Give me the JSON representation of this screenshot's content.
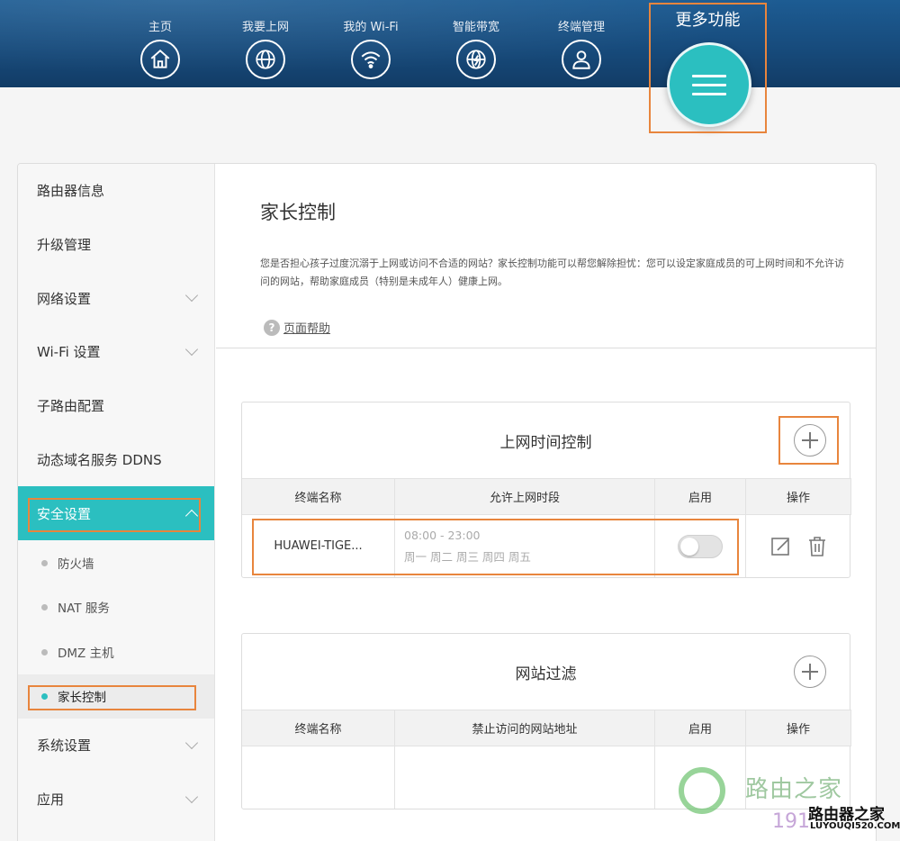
{
  "nav": {
    "items": [
      {
        "label": "主页",
        "icon": "home-icon"
      },
      {
        "label": "我要上网",
        "icon": "globe-icon"
      },
      {
        "label": "我的 Wi-Fi",
        "icon": "wifi-icon"
      },
      {
        "label": "智能带宽",
        "icon": "bandwidth-icon"
      },
      {
        "label": "终端管理",
        "icon": "user-icon"
      }
    ],
    "more_label": "更多功能"
  },
  "sidebar": {
    "items": [
      {
        "label": "路由器信息"
      },
      {
        "label": "升级管理"
      },
      {
        "label": "网络设置"
      },
      {
        "label": "Wi-Fi 设置"
      },
      {
        "label": "子路由配置"
      },
      {
        "label": "动态域名服务 DDNS"
      },
      {
        "label": "安全设置"
      }
    ],
    "sub_items": [
      {
        "label": "防火墙"
      },
      {
        "label": "NAT 服务"
      },
      {
        "label": "DMZ 主机"
      },
      {
        "label": "家长控制"
      }
    ],
    "bottom_items": [
      {
        "label": "系统设置"
      },
      {
        "label": "应用"
      }
    ]
  },
  "content": {
    "title": "家长控制",
    "description": "您是否担心孩子过度沉溺于上网或访问不合适的网站？家长控制功能可以帮您解除担忧：您可以设定家庭成员的可上网时间和不允许访问的网站，帮助家庭成员（特别是未成年人）健康上网。",
    "help_label": "页面帮助"
  },
  "time_control": {
    "title": "上网时间控制",
    "columns": [
      "终端名称",
      "允许上网时段",
      "启用",
      "操作"
    ],
    "rows": [
      {
        "device": "HUAWEI-TIGE...",
        "time": "08:00 - 23:00",
        "days": "周一 周二 周三 周四 周五",
        "enabled": false
      }
    ]
  },
  "site_filter": {
    "title": "网站过滤",
    "columns": [
      "终端名称",
      "禁止访问的网站地址",
      "启用",
      "操作"
    ]
  },
  "watermark": {
    "text": "路由之家",
    "sub": "路由器之家",
    "num": "191",
    "url": "LUYOUQI520.COM"
  },
  "colors": {
    "accent": "#2bbfc0",
    "highlight": "#e8853d",
    "header": "#174b7c"
  }
}
